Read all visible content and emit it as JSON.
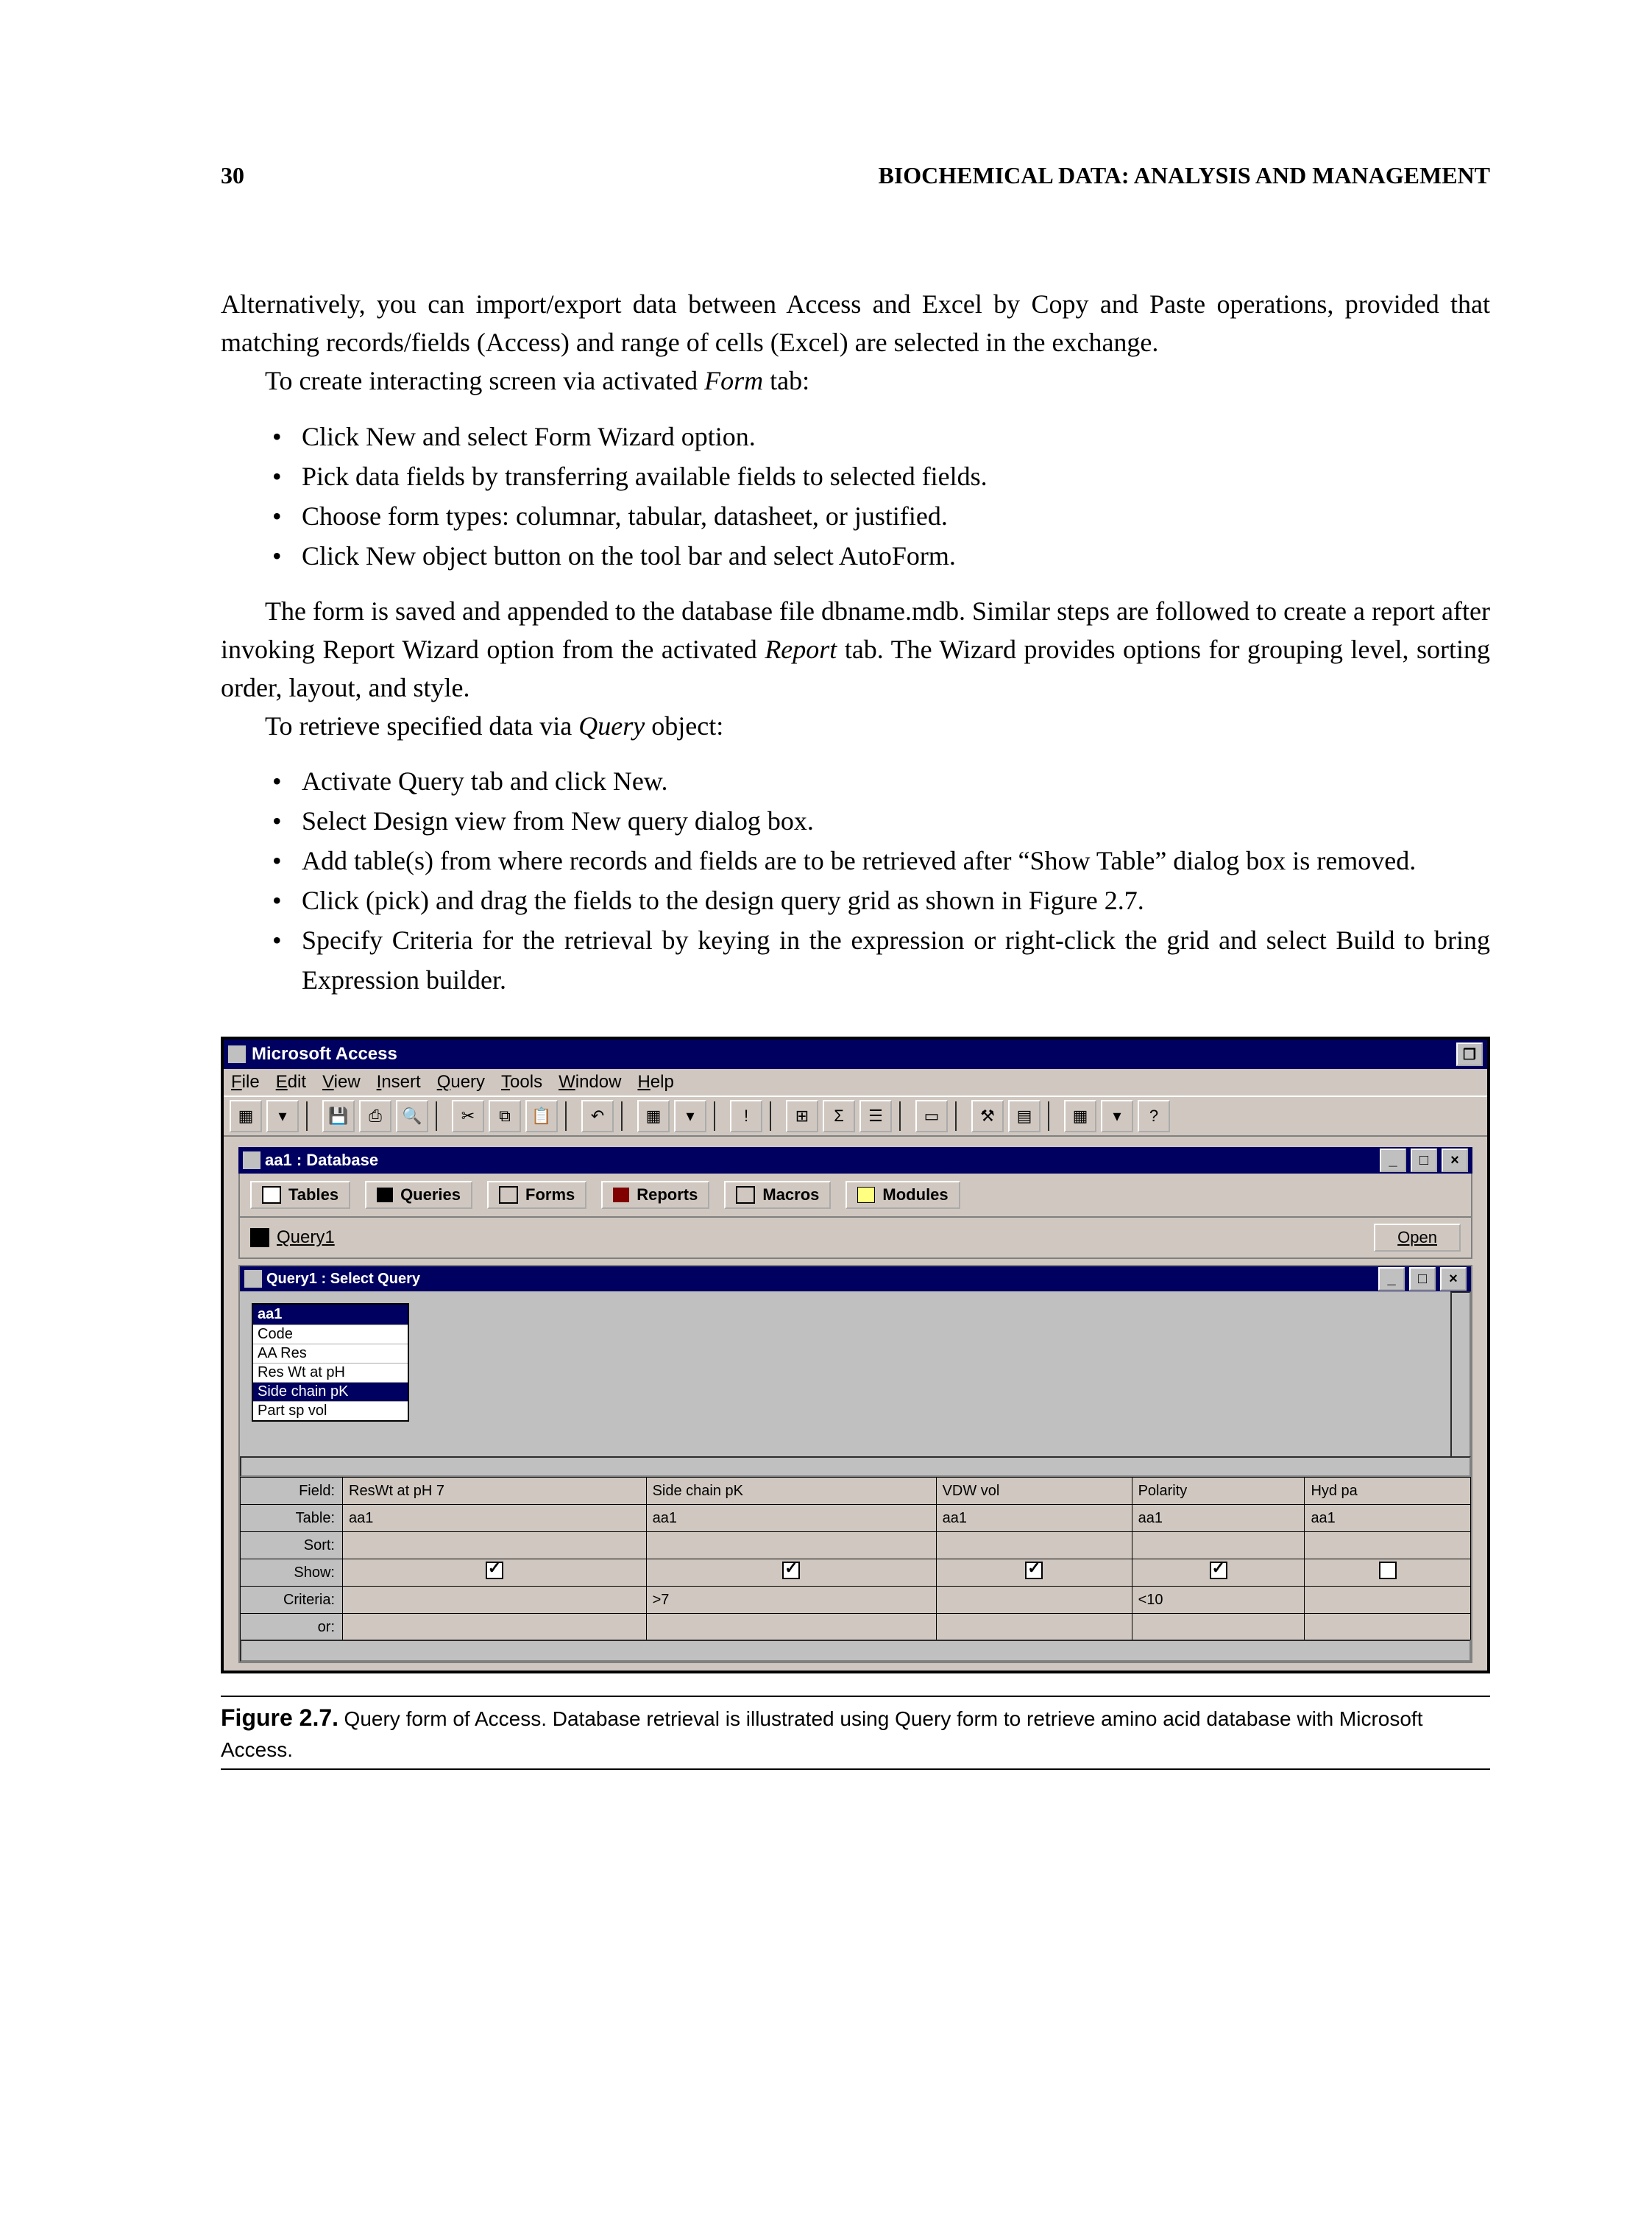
{
  "page": {
    "number": "30",
    "running_title": "BIOCHEMICAL DATA: ANALYSIS AND MANAGEMENT"
  },
  "paragraphs": {
    "p1": "Alternatively, you can import/export data between Access and Excel by Copy and Paste operations, provided that matching records/fields (Access) and range of cells (Excel) are selected in the exchange.",
    "p2a": "To create interacting screen via activated ",
    "p2i": "Form",
    "p2b": " tab:",
    "p3": "The form is saved and appended to the database file dbname.mdb. Similar steps are followed to create a report after invoking Report Wizard option from the activated ",
    "p3i": "Report",
    "p3b": " tab. The Wizard provides options for grouping level, sorting order, layout, and style.",
    "p4a": "To retrieve specified data via ",
    "p4i": "Query",
    "p4b": " object:"
  },
  "bullets1": [
    "Click New and select Form Wizard option.",
    "Pick data fields by transferring available fields to selected fields.",
    "Choose form types: columnar, tabular, datasheet, or justified.",
    "Click New object button on the tool bar and select AutoForm."
  ],
  "bullets2": [
    "Activate Query tab and click New.",
    "Select Design view from New query dialog box.",
    "Add table(s) from where records and fields are to be retrieved after “Show Table” dialog box is removed.",
    "Click (pick) and drag the fields to the design query grid as shown in Figure 2.7.",
    "Specify Criteria for the retrieval by keying in the expression or right-click the grid and select Build to bring Expression builder."
  ],
  "access": {
    "app_title": "Microsoft Access",
    "menu": [
      "File",
      "Edit",
      "View",
      "Insert",
      "Query",
      "Tools",
      "Window",
      "Help"
    ],
    "db_title": "aa1 : Database",
    "tabs": {
      "tables": "Tables",
      "queries": "Queries",
      "forms": "Forms",
      "reports": "Reports",
      "macros": "Macros",
      "modules": "Modules"
    },
    "query_item": "Query1",
    "open_btn": "Open",
    "design_title": "Query1 : Select Query",
    "table_box": {
      "header": "aa1",
      "fields": [
        "Code",
        "AA Res",
        "Res Wt at pH",
        "Side chain pK",
        "Part sp vol"
      ]
    },
    "grid": {
      "rows": [
        "Field:",
        "Table:",
        "Sort:",
        "Show:",
        "Criteria:",
        "or:"
      ],
      "cols": [
        {
          "field": "ResWt at pH 7",
          "table": "aa1",
          "show": true,
          "criteria": ""
        },
        {
          "field": "Side chain pK",
          "table": "aa1",
          "show": true,
          "criteria": ">7"
        },
        {
          "field": "VDW vol",
          "table": "aa1",
          "show": true,
          "criteria": ""
        },
        {
          "field": "Polarity",
          "table": "aa1",
          "show": true,
          "criteria": "<10"
        },
        {
          "field": "Hyd pa",
          "table": "aa1",
          "show": false,
          "criteria": ""
        }
      ]
    }
  },
  "caption": {
    "label": "Figure 2.7.",
    "text": "Query form of Access. Database retrieval is illustrated using Query form to retrieve amino acid database with Microsoft Access."
  }
}
